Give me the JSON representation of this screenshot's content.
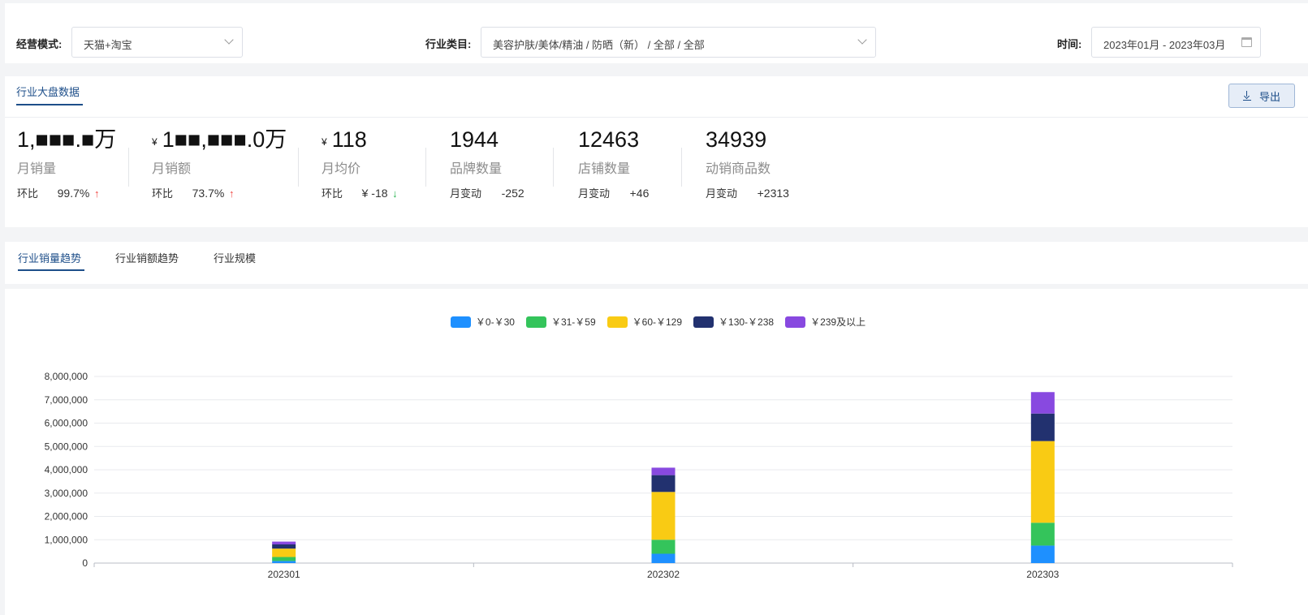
{
  "filters": {
    "mode_label": "经营模式:",
    "mode_value": "天猫+淘宝",
    "category_label": "行业类目:",
    "category_value": "美容护肤/美体/精油 / 防晒（新） / 全部 / 全部",
    "time_label": "时间:",
    "time_value": "2023年01月 - 2023年03月"
  },
  "overview": {
    "tab_label": "行业大盘数据",
    "export_label": "导出",
    "kpis": [
      {
        "value": "1,■■■.■万",
        "label": "月销量",
        "change_label": "环比",
        "change_value": "99.7%",
        "trend": "up"
      },
      {
        "currency": "¥",
        "value": "1■■,■■■.0万",
        "label": "月销额",
        "change_label": "环比",
        "change_value": "73.7%",
        "trend": "up"
      },
      {
        "currency": "¥",
        "value": "118",
        "label": "月均价",
        "change_label": "环比",
        "change_value": "¥ -18",
        "trend": "down"
      },
      {
        "value": "1944",
        "label": "品牌数量",
        "change_label": "月变动",
        "change_value": "-252"
      },
      {
        "value": "12463",
        "label": "店铺数量",
        "change_label": "月变动",
        "change_value": "+46"
      },
      {
        "value": "34939",
        "label": "动销商品数",
        "change_label": "月变动",
        "change_value": "+2313"
      }
    ],
    "arrows": {
      "up": "↑",
      "down": "↓"
    }
  },
  "chart_tabs": [
    {
      "label": "行业销量趋势",
      "active": true
    },
    {
      "label": "行业销额趋势",
      "active": false
    },
    {
      "label": "行业规模",
      "active": false
    }
  ],
  "chart_data": {
    "type": "bar",
    "stacked": true,
    "categories": [
      "202301",
      "202302",
      "202303"
    ],
    "series": [
      {
        "name": "￥0-￥30",
        "color": "#1e90ff",
        "values": [
          90000,
          400000,
          750000
        ]
      },
      {
        "name": "￥31-￥59",
        "color": "#34c45b",
        "values": [
          170000,
          600000,
          980000
        ]
      },
      {
        "name": "￥60-￥129",
        "color": "#f9cb14",
        "values": [
          360000,
          2050000,
          3500000
        ]
      },
      {
        "name": "￥130-￥238",
        "color": "#22316f",
        "values": [
          180000,
          720000,
          1180000
        ]
      },
      {
        "name": "￥239及以上",
        "color": "#8849e0",
        "values": [
          120000,
          320000,
          920000
        ]
      }
    ],
    "y_ticks": [
      "0",
      "1,000,000",
      "2,000,000",
      "3,000,000",
      "4,000,000",
      "5,000,000",
      "6,000,000",
      "7,000,000",
      "8,000,000"
    ],
    "ylim": [
      0,
      8000000
    ],
    "grid": true,
    "legend_position": "top-center"
  }
}
